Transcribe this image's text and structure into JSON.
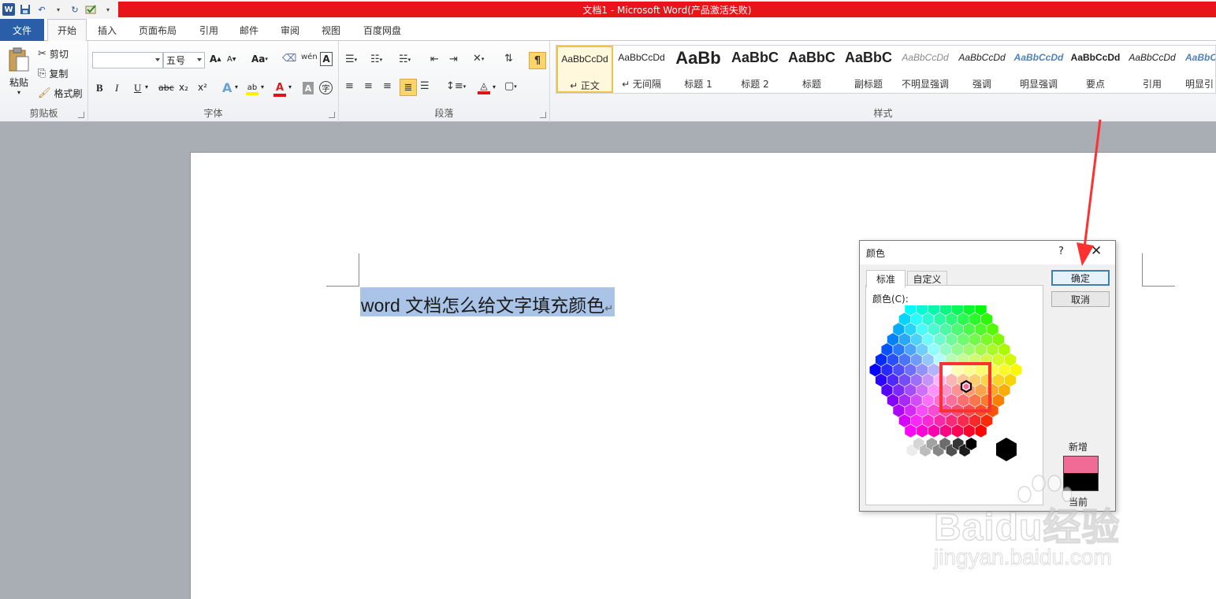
{
  "window": {
    "title": "文档1 - Microsoft Word(产品激活失败)",
    "app_icon": "W"
  },
  "quick_access": [
    {
      "name": "save-icon",
      "glyph": "🖫"
    },
    {
      "name": "undo-icon",
      "glyph": "↶"
    },
    {
      "name": "redo-icon",
      "glyph": "↻"
    },
    {
      "name": "customize-icon",
      "glyph": "▾"
    }
  ],
  "tabs": [
    "文件",
    "开始",
    "插入",
    "页面布局",
    "引用",
    "邮件",
    "审阅",
    "视图",
    "百度网盘"
  ],
  "clipboard": {
    "label": "剪贴板",
    "paste": "粘贴",
    "cut": "剪切",
    "copy": "复制",
    "format_painter": "格式刷"
  },
  "font": {
    "label": "字体",
    "font_name": "",
    "font_size": "五号",
    "grow": "A",
    "shrink": "A",
    "change_case": "Aa",
    "bold": "B",
    "italic": "I",
    "underline": "U",
    "strike": "abc",
    "subscript": "x₂",
    "superscript": "x²"
  },
  "paragraph": {
    "label": "段落"
  },
  "styles": {
    "label": "样式",
    "items": [
      {
        "sample": "AaBbCcDd",
        "name": "↵ 正文"
      },
      {
        "sample": "AaBbCcDd",
        "name": "↵ 无间隔"
      },
      {
        "sample": "AaBb",
        "name": "标题 1"
      },
      {
        "sample": "AaBbC",
        "name": "标题 2"
      },
      {
        "sample": "AaBbC",
        "name": "标题"
      },
      {
        "sample": "AaBbC",
        "name": "副标题"
      },
      {
        "sample": "AaBbCcDd",
        "name": "不明显强调"
      },
      {
        "sample": "AaBbCcDd",
        "name": "强调"
      },
      {
        "sample": "AaBbCcDd",
        "name": "明显强调"
      },
      {
        "sample": "AaBbCcDd",
        "name": "要点"
      },
      {
        "sample": "AaBbCcDd",
        "name": "引用"
      },
      {
        "sample": "AaBbCc",
        "name": "明显引"
      }
    ]
  },
  "document": {
    "text": "word 文档怎么给文字填充颜色",
    "para_mark": "↵"
  },
  "dialog": {
    "title": "颜色",
    "help": "?",
    "close": "✕",
    "tab_standard": "标准",
    "tab_custom": "自定义",
    "colors_label": "颜色(C):",
    "ok": "确定",
    "cancel": "取消",
    "new_label": "新增",
    "current_label": "当前",
    "new_color": "#f06c96",
    "current_color": "#000000"
  },
  "colors": {
    "accent_tab": "#2a5ea9",
    "title_red": "#e8141a",
    "selection": "#a9c4e6",
    "annotation": "#ff3030"
  },
  "watermark": {
    "brand": "Baidu经验",
    "url": "jingyan.baidu.com"
  }
}
